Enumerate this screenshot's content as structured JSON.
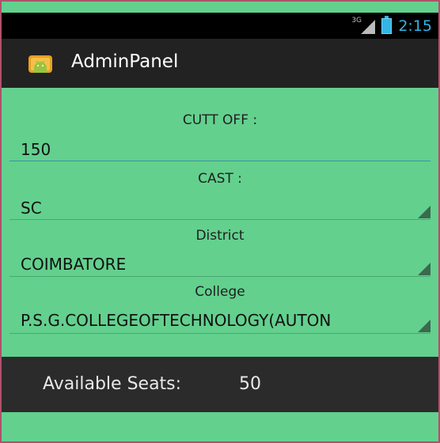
{
  "status": {
    "network": "3G",
    "time": "2:15"
  },
  "app": {
    "title": "AdminPanel"
  },
  "form": {
    "cutoff_label": "CUTT OFF :",
    "cutoff_value": "150",
    "cast_label": "CAST :",
    "cast_value": "SC",
    "district_label": "District",
    "district_value": "COIMBATORE",
    "college_label": "College",
    "college_value": "P.S.G.COLLEGEOFTECHNOLOGY(AUTON"
  },
  "seats": {
    "label": "Available Seats:",
    "value": "50"
  },
  "colors": {
    "background": "#63d08e",
    "actionbar": "#222222",
    "accent": "#33b5e5",
    "seats_bar": "#2b2b2b"
  },
  "icons": [
    "signal-icon",
    "battery-icon",
    "android-app-icon",
    "spinner-arrow-icon"
  ]
}
